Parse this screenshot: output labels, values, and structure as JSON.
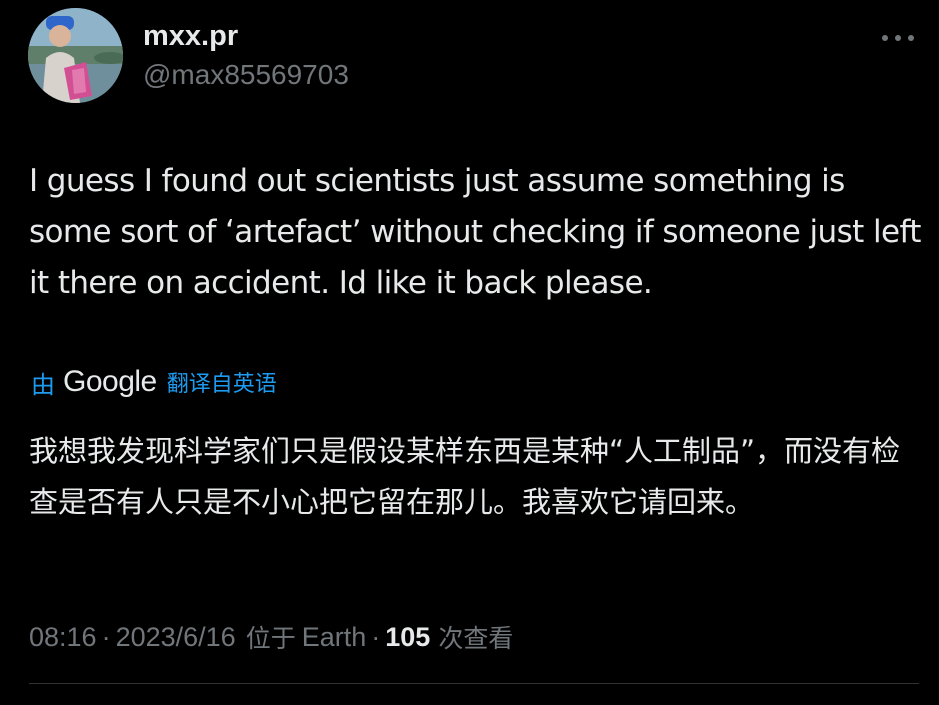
{
  "user": {
    "display_name": "mxx.pr",
    "handle": "@max85569703",
    "avatar_icon": "user-photo-avatar"
  },
  "more_icon": "more-dots-icon",
  "tweet": {
    "text": "I guess I found out scientists just assume something is some sort of ‘artefact’ without checking if someone just left it there on accident. Id like it back please."
  },
  "translation": {
    "by_label": "由",
    "provider": "Google",
    "from_label": "翻译自英语",
    "text": "我想我发现科学家们只是假设某样东西是某种“人工制品”，而没有检查是否有人只是不小心把它留在那儿。我喜欢它请回来。"
  },
  "meta": {
    "time": "08:16",
    "separator": "·",
    "date": "2023/6/16",
    "location_prefix": "位于",
    "location": "Earth",
    "views_count": "105",
    "views_label": "次查看"
  },
  "colors": {
    "background": "#000000",
    "text_primary": "#e7e9ea",
    "text_secondary": "#71767b",
    "link_blue": "#1d9bf0",
    "divider": "#2f3336"
  }
}
